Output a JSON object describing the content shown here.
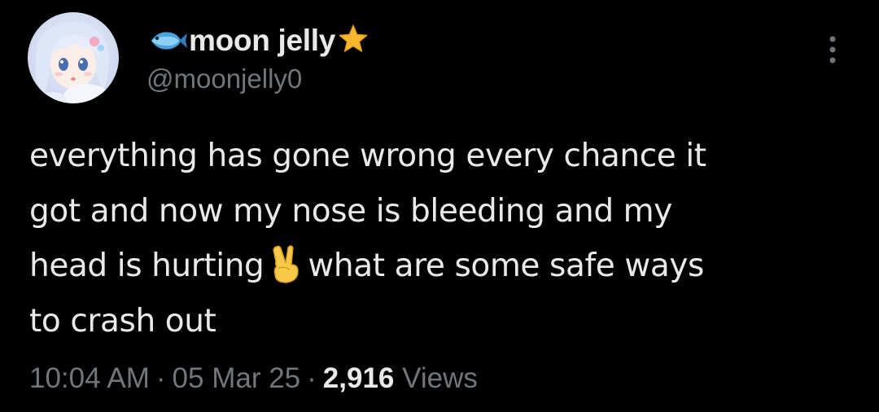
{
  "author": {
    "display_name": "moon jelly",
    "handle": "@moonjelly0",
    "name_emoji_left": "fish-icon",
    "name_emoji_right": "star-icon"
  },
  "tweet": {
    "text_lines": [
      "everything has gone wrong every chance it",
      "got and now my nose is bleeding and my",
      "head is hurting",
      "what are some safe ways",
      "to crash out"
    ],
    "inline_emoji": "victory-hand-icon"
  },
  "meta": {
    "time": "10:04 AM",
    "separator": "·",
    "date": "05 Mar 25",
    "views_count": "2,916",
    "views_label": "Views"
  },
  "colors": {
    "background": "#000000",
    "text_primary": "#e7e9ea",
    "text_secondary": "#71767b"
  }
}
